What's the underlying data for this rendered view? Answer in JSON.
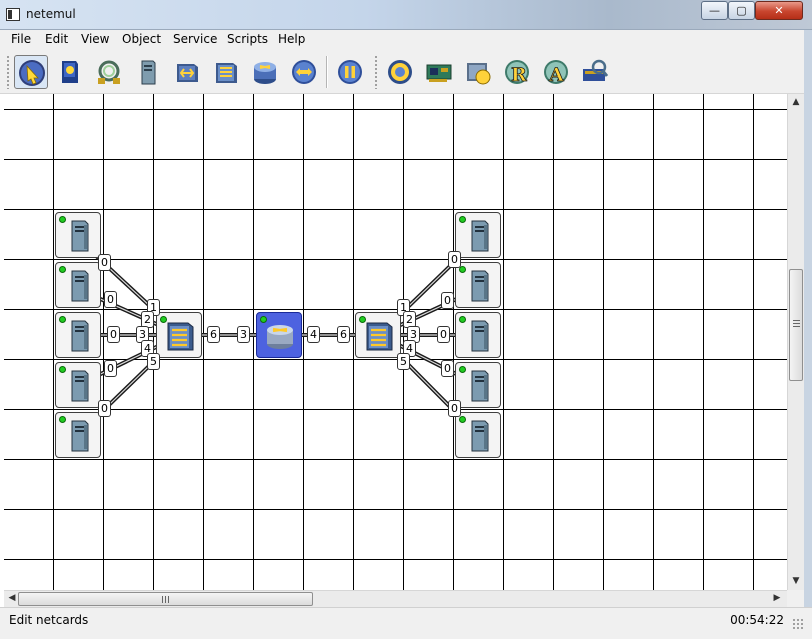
{
  "window": {
    "title": "netemul"
  },
  "menu": {
    "items": [
      "File",
      "Edit",
      "View",
      "Object",
      "Service",
      "Scripts",
      "Help"
    ]
  },
  "toolbar": {
    "tools": [
      {
        "name": "select-tool",
        "icon": "pointer-icon",
        "active": true
      },
      {
        "name": "note-tool",
        "icon": "note-icon"
      },
      {
        "name": "cable-tool",
        "icon": "cable-icon"
      },
      {
        "name": "computer-tool",
        "icon": "computer-icon"
      },
      {
        "name": "hub-tool",
        "icon": "hub-icon"
      },
      {
        "name": "switch-tool",
        "icon": "switch-icon"
      },
      {
        "name": "router-tool",
        "icon": "router-icon"
      },
      {
        "name": "send-tool",
        "icon": "send-icon"
      },
      {
        "name": "pause-tool",
        "icon": "pause-icon"
      },
      {
        "name": "settings-tool",
        "icon": "gear-icon"
      },
      {
        "name": "netcard-tool",
        "icon": "netcard-icon"
      },
      {
        "name": "program-tool",
        "icon": "program-icon"
      },
      {
        "name": "rip-tool",
        "icon": "letter-r-icon"
      },
      {
        "name": "arp-tool",
        "icon": "letter-a-icon"
      },
      {
        "name": "table-tool",
        "icon": "table-icon"
      }
    ]
  },
  "network": {
    "nodes": [
      {
        "id": "pc-l1",
        "type": "computer"
      },
      {
        "id": "pc-l2",
        "type": "computer"
      },
      {
        "id": "pc-l3",
        "type": "computer"
      },
      {
        "id": "pc-l4",
        "type": "computer"
      },
      {
        "id": "pc-l5",
        "type": "computer"
      },
      {
        "id": "switch-left",
        "type": "switch"
      },
      {
        "id": "router",
        "type": "router",
        "selected": true
      },
      {
        "id": "switch-right",
        "type": "switch"
      },
      {
        "id": "pc-r1",
        "type": "computer"
      },
      {
        "id": "pc-r2",
        "type": "computer"
      },
      {
        "id": "pc-r3",
        "type": "computer"
      },
      {
        "id": "pc-r4",
        "type": "computer"
      },
      {
        "id": "pc-r5",
        "type": "computer"
      }
    ],
    "ports": {
      "pc_left": [
        "0",
        "0",
        "0",
        "0",
        "0"
      ],
      "switch_left": [
        "1",
        "2",
        "3",
        "4",
        "5"
      ],
      "switch_left_uplink": "6",
      "router_left": "3",
      "router_right": "4",
      "switch_right_uplink": "6",
      "switch_right": [
        "1",
        "2",
        "3",
        "4",
        "5"
      ],
      "pc_right": [
        "0",
        "0",
        "0",
        "0",
        "0"
      ]
    }
  },
  "scroll": {
    "h_arrow_left": "◀",
    "h_arrow_right": "▶",
    "v_arrow_up": "▲",
    "v_arrow_down": "▼",
    "h_grip": "III",
    "v_grip": "≡"
  },
  "status": {
    "message": "Edit netcards",
    "time": "00:54:22"
  }
}
